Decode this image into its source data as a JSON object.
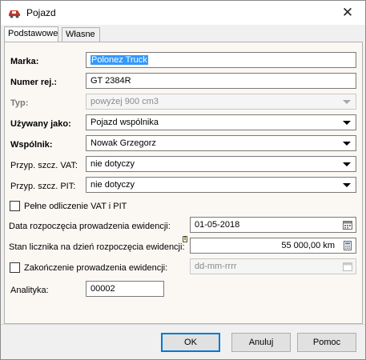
{
  "window": {
    "title": "Pojazd",
    "close_glyph": "✕"
  },
  "tabs": [
    {
      "label": "Podstawowe",
      "active": true
    },
    {
      "label": "Własne",
      "active": false
    }
  ],
  "form": {
    "marka": {
      "label": "Marka:",
      "value": "Polonez Truck"
    },
    "numer_rej": {
      "label": "Numer rej.:",
      "value": "GT 2384R"
    },
    "typ": {
      "label": "Typ:",
      "value": "powyżej 900 cm3"
    },
    "uzywany_jako": {
      "label": "Używany jako:",
      "value": "Pojazd wspólnika"
    },
    "wspolnik": {
      "label": "Wspólnik:",
      "value": "Nowak Grzegorz"
    },
    "przyp_vat": {
      "label": "Przyp. szcz. VAT:",
      "value": "nie dotyczy"
    },
    "przyp_pit": {
      "label": "Przyp. szcz. PIT:",
      "value": "nie dotyczy"
    },
    "pelne_odliczenie": {
      "label": "Pełne odliczenie VAT i PIT",
      "checked": false
    },
    "data_rozpoczecia": {
      "label": "Data rozpoczęcia prowadzenia ewidencji:",
      "value": "01-05-2018"
    },
    "stan_licznika": {
      "label": "Stan licznika na dzień rozpoczęcia ewidencji:",
      "value": "55 000,00 km",
      "marker": "!"
    },
    "zakonczenie": {
      "label": "Zakończenie prowadzenia ewidencji:",
      "checked": false,
      "placeholder": "dd-mm-rrrr"
    },
    "analityka": {
      "label": "Analityka:",
      "value": "00002"
    }
  },
  "buttons": {
    "ok": "OK",
    "cancel": "Anuluj",
    "help": "Pomoc"
  },
  "colors": {
    "selection": "#3399ff",
    "panel_bg": "#fbf8f4",
    "window_bg": "#f0f0f0",
    "default_button_border": "#0078d7",
    "app_icon": "#c0392b"
  },
  "icons": {
    "app": "car-icon",
    "close": "close-icon",
    "calendar": "calendar-icon",
    "calculator": "calculator-icon",
    "dropdown": "chevron-down-icon"
  }
}
